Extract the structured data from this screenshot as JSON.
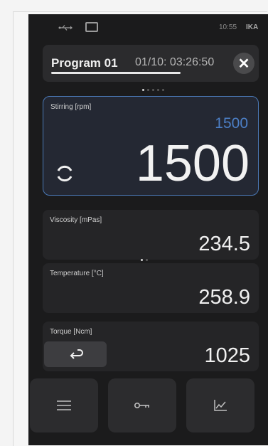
{
  "status_bar": {
    "time": "10:55",
    "brand": "IKA",
    "icons": [
      "usb-icon",
      "monitor-icon"
    ]
  },
  "program": {
    "name": "Program 01",
    "time": "01/10: 03:26:50",
    "progress_percent": 60,
    "close_label": "✕"
  },
  "page_dots": {
    "count": 5,
    "active": 0
  },
  "stirring": {
    "label": "Stirring [rpm]",
    "setpoint": "1500",
    "value": "1500",
    "accent": "#4c7fc6"
  },
  "viscosity": {
    "label": "Viscosity [mPas]",
    "value": "234.5"
  },
  "mid_dots": {
    "count": 2,
    "active": 0
  },
  "temperature": {
    "label": "Temperature [°C]",
    "value": "258.9"
  },
  "torque": {
    "label": "Torque [Ncm]",
    "value": "1025"
  },
  "bottom_buttons": [
    "menu-icon",
    "key-icon",
    "chart-icon"
  ]
}
